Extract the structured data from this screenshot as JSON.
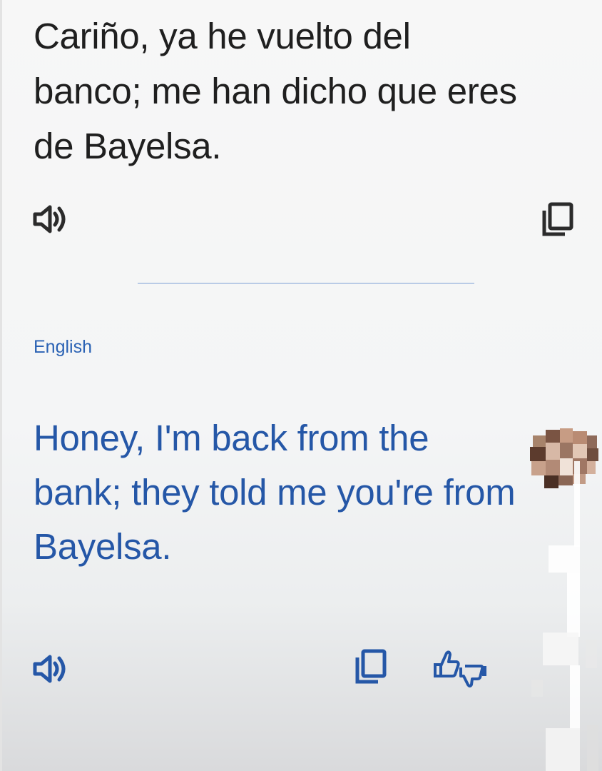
{
  "source": {
    "text": "Cariño, ya he vuelto del banco; me han dicho que eres de Bayelsa.",
    "speaker_icon": "speaker-icon",
    "copy_icon": "copy-icon"
  },
  "target": {
    "language": "English",
    "text": "Honey, I'm back from the bank; they told me you're from Bayelsa.",
    "speaker_icon": "speaker-icon",
    "copy_icon": "copy-icon",
    "feedback_icon": "thumbs-feedback-icon"
  },
  "colors": {
    "source_text": "#1f1f1f",
    "translation_text": "#2557a7",
    "accent": "#2a62b4",
    "divider": "#b9cbe6"
  }
}
